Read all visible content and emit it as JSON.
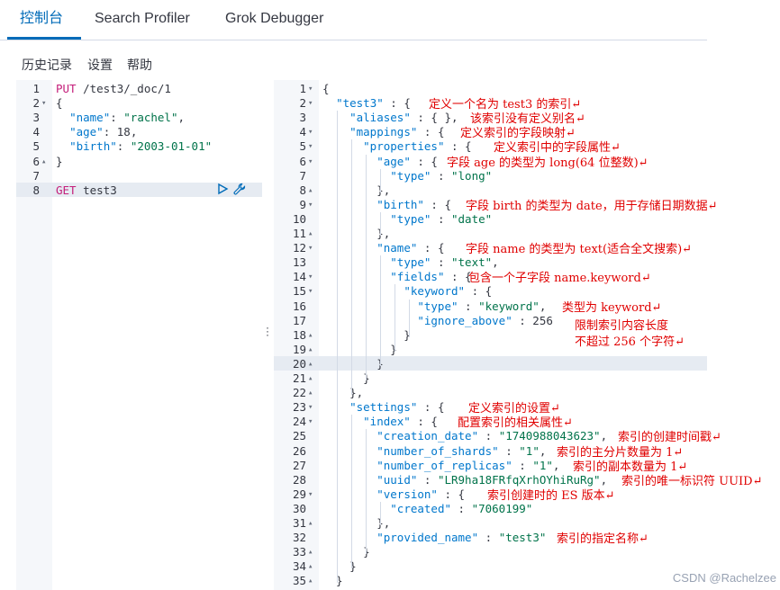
{
  "tabs": [
    "控制台",
    "Search Profiler",
    "Grok Debugger"
  ],
  "menu": [
    "历史记录",
    "设置",
    "帮助"
  ],
  "request_lines": [
    {
      "n": "1",
      "fold": "",
      "tokens": [
        [
          "m",
          "PUT"
        ],
        [
          "p",
          " /test3/_doc/1"
        ]
      ]
    },
    {
      "n": "2",
      "fold": "▾",
      "tokens": [
        [
          "p",
          "{"
        ]
      ]
    },
    {
      "n": "3",
      "fold": "",
      "tokens": [
        [
          "p",
          "  "
        ],
        [
          "k",
          "\"name\""
        ],
        [
          "p",
          ": "
        ],
        [
          "s",
          "\"rachel\""
        ],
        [
          "p",
          ","
        ]
      ]
    },
    {
      "n": "4",
      "fold": "",
      "tokens": [
        [
          "p",
          "  "
        ],
        [
          "k",
          "\"age\""
        ],
        [
          "p",
          ": "
        ],
        [
          "n",
          "18"
        ],
        [
          "p",
          ","
        ]
      ]
    },
    {
      "n": "5",
      "fold": "",
      "tokens": [
        [
          "p",
          "  "
        ],
        [
          "k",
          "\"birth\""
        ],
        [
          "p",
          ": "
        ],
        [
          "s",
          "\"2003-01-01\""
        ]
      ]
    },
    {
      "n": "6",
      "fold": "▴",
      "tokens": [
        [
          "p",
          "}"
        ]
      ]
    },
    {
      "n": "7",
      "fold": "",
      "tokens": []
    },
    {
      "n": "8",
      "fold": "",
      "tokens": [
        [
          "m",
          "GET"
        ],
        [
          "p",
          " test3"
        ]
      ]
    }
  ],
  "response_lines": [
    {
      "n": "1",
      "fold": "▾",
      "tokens": [
        [
          "p",
          "{"
        ]
      ]
    },
    {
      "n": "2",
      "fold": "▾",
      "tokens": [
        [
          "p",
          "  "
        ],
        [
          "k",
          "\"test3\""
        ],
        [
          "p",
          " : {"
        ]
      ]
    },
    {
      "n": "3",
      "fold": "",
      "tokens": [
        [
          "p",
          "    "
        ],
        [
          "k",
          "\"aliases\""
        ],
        [
          "p",
          " : { },"
        ]
      ]
    },
    {
      "n": "4",
      "fold": "▾",
      "tokens": [
        [
          "p",
          "    "
        ],
        [
          "k",
          "\"mappings\""
        ],
        [
          "p",
          " : {"
        ]
      ]
    },
    {
      "n": "5",
      "fold": "▾",
      "tokens": [
        [
          "p",
          "      "
        ],
        [
          "k",
          "\"properties\""
        ],
        [
          "p",
          " : {"
        ]
      ]
    },
    {
      "n": "6",
      "fold": "▾",
      "tokens": [
        [
          "p",
          "        "
        ],
        [
          "k",
          "\"age\""
        ],
        [
          "p",
          " : {"
        ]
      ]
    },
    {
      "n": "7",
      "fold": "",
      "tokens": [
        [
          "p",
          "          "
        ],
        [
          "k",
          "\"type\""
        ],
        [
          "p",
          " : "
        ],
        [
          "s",
          "\"long\""
        ]
      ]
    },
    {
      "n": "8",
      "fold": "▴",
      "tokens": [
        [
          "p",
          "        },"
        ]
      ]
    },
    {
      "n": "9",
      "fold": "▾",
      "tokens": [
        [
          "p",
          "        "
        ],
        [
          "k",
          "\"birth\""
        ],
        [
          "p",
          " : {"
        ]
      ]
    },
    {
      "n": "10",
      "fold": "",
      "tokens": [
        [
          "p",
          "          "
        ],
        [
          "k",
          "\"type\""
        ],
        [
          "p",
          " : "
        ],
        [
          "s",
          "\"date\""
        ]
      ]
    },
    {
      "n": "11",
      "fold": "▴",
      "tokens": [
        [
          "p",
          "        },"
        ]
      ]
    },
    {
      "n": "12",
      "fold": "▾",
      "tokens": [
        [
          "p",
          "        "
        ],
        [
          "k",
          "\"name\""
        ],
        [
          "p",
          " : {"
        ]
      ]
    },
    {
      "n": "13",
      "fold": "",
      "tokens": [
        [
          "p",
          "          "
        ],
        [
          "k",
          "\"type\""
        ],
        [
          "p",
          " : "
        ],
        [
          "s",
          "\"text\""
        ],
        [
          "p",
          ","
        ]
      ]
    },
    {
      "n": "14",
      "fold": "▾",
      "tokens": [
        [
          "p",
          "          "
        ],
        [
          "k",
          "\"fields\""
        ],
        [
          "p",
          " : {"
        ]
      ]
    },
    {
      "n": "15",
      "fold": "▾",
      "tokens": [
        [
          "p",
          "            "
        ],
        [
          "k",
          "\"keyword\""
        ],
        [
          "p",
          " : {"
        ]
      ]
    },
    {
      "n": "16",
      "fold": "",
      "tokens": [
        [
          "p",
          "              "
        ],
        [
          "k",
          "\"type\""
        ],
        [
          "p",
          " : "
        ],
        [
          "s",
          "\"keyword\""
        ],
        [
          "p",
          ","
        ]
      ]
    },
    {
      "n": "17",
      "fold": "",
      "tokens": [
        [
          "p",
          "              "
        ],
        [
          "k",
          "\"ignore_above\""
        ],
        [
          "p",
          " : "
        ],
        [
          "n",
          "256"
        ]
      ]
    },
    {
      "n": "18",
      "fold": "▴",
      "tokens": [
        [
          "p",
          "            }"
        ]
      ]
    },
    {
      "n": "19",
      "fold": "▴",
      "tokens": [
        [
          "p",
          "          }"
        ]
      ]
    },
    {
      "n": "20",
      "fold": "▴",
      "tokens": [
        [
          "p",
          "        }"
        ]
      ]
    },
    {
      "n": "21",
      "fold": "▴",
      "tokens": [
        [
          "p",
          "      }"
        ]
      ]
    },
    {
      "n": "22",
      "fold": "▴",
      "tokens": [
        [
          "p",
          "    },"
        ]
      ]
    },
    {
      "n": "23",
      "fold": "▾",
      "tokens": [
        [
          "p",
          "    "
        ],
        [
          "k",
          "\"settings\""
        ],
        [
          "p",
          " : {"
        ]
      ]
    },
    {
      "n": "24",
      "fold": "▾",
      "tokens": [
        [
          "p",
          "      "
        ],
        [
          "k",
          "\"index\""
        ],
        [
          "p",
          " : {"
        ]
      ]
    },
    {
      "n": "25",
      "fold": "",
      "tokens": [
        [
          "p",
          "        "
        ],
        [
          "k",
          "\"creation_date\""
        ],
        [
          "p",
          " : "
        ],
        [
          "s",
          "\"1740988043623\""
        ],
        [
          "p",
          ","
        ]
      ]
    },
    {
      "n": "26",
      "fold": "",
      "tokens": [
        [
          "p",
          "        "
        ],
        [
          "k",
          "\"number_of_shards\""
        ],
        [
          "p",
          " : "
        ],
        [
          "s",
          "\"1\""
        ],
        [
          "p",
          ","
        ]
      ]
    },
    {
      "n": "27",
      "fold": "",
      "tokens": [
        [
          "p",
          "        "
        ],
        [
          "k",
          "\"number_of_replicas\""
        ],
        [
          "p",
          " : "
        ],
        [
          "s",
          "\"1\""
        ],
        [
          "p",
          ","
        ]
      ]
    },
    {
      "n": "28",
      "fold": "",
      "tokens": [
        [
          "p",
          "        "
        ],
        [
          "k",
          "\"uuid\""
        ],
        [
          "p",
          " : "
        ],
        [
          "s",
          "\"LR9ha18FRfqXrhOYhiRuRg\""
        ],
        [
          "p",
          ","
        ]
      ]
    },
    {
      "n": "29",
      "fold": "▾",
      "tokens": [
        [
          "p",
          "        "
        ],
        [
          "k",
          "\"version\""
        ],
        [
          "p",
          " : {"
        ]
      ]
    },
    {
      "n": "30",
      "fold": "",
      "tokens": [
        [
          "p",
          "          "
        ],
        [
          "k",
          "\"created\""
        ],
        [
          "p",
          " : "
        ],
        [
          "s",
          "\"7060199\""
        ]
      ]
    },
    {
      "n": "31",
      "fold": "▴",
      "tokens": [
        [
          "p",
          "        },"
        ]
      ]
    },
    {
      "n": "32",
      "fold": "",
      "tokens": [
        [
          "p",
          "        "
        ],
        [
          "k",
          "\"provided_name\""
        ],
        [
          "p",
          " : "
        ],
        [
          "s",
          "\"test3\""
        ]
      ]
    },
    {
      "n": "33",
      "fold": "▴",
      "tokens": [
        [
          "p",
          "      }"
        ]
      ]
    },
    {
      "n": "34",
      "fold": "▴",
      "tokens": [
        [
          "p",
          "    }"
        ]
      ]
    },
    {
      "n": "35",
      "fold": "▴",
      "tokens": [
        [
          "p",
          "  }"
        ]
      ]
    }
  ],
  "annotations": [
    {
      "line": "2",
      "text": "定义一个名为 test3 的索引↵"
    },
    {
      "line": "3",
      "text": "该索引没有定义别名↵"
    },
    {
      "line": "4",
      "text": "定义索引的字段映射↵"
    },
    {
      "line": "5",
      "text": "定义索引中的字段属性↵"
    },
    {
      "line": "6",
      "text": "字段 age 的类型为 long(64 位整数)↵"
    },
    {
      "line": "9",
      "text": "字段 birth 的类型为 date，用于存储日期数据↵"
    },
    {
      "line": "12",
      "text": "字段 name 的类型为 text(适合全文搜索)↵"
    },
    {
      "line": "14",
      "text": "包含一个子字段 name.keyword↵"
    },
    {
      "line": "16",
      "text": "类型为 keyword↵"
    },
    {
      "line": "17",
      "text": "限制索引内容长度"
    },
    {
      "line": "18",
      "text": "不超过 256 个字符↵"
    },
    {
      "line": "23",
      "text": "定义索引的设置↵"
    },
    {
      "line": "24",
      "text": "配置索引的相关属性↵"
    },
    {
      "line": "25",
      "text": "索引的创建时间戳↵"
    },
    {
      "line": "26",
      "text": "索引的主分片数量为 1↵"
    },
    {
      "line": "27",
      "text": "索引的副本数量为 1↵"
    },
    {
      "line": "28",
      "text": "索引的唯一标识符 UUID↵"
    },
    {
      "line": "29",
      "text": "索引创建时的 ES 版本↵"
    },
    {
      "line": "32",
      "text": "索引的指定名称↵"
    }
  ],
  "watermark": "CSDN @Rachelzee",
  "colors": {
    "accent": "#006bb8",
    "annotation": "#e00000",
    "method": "#c41e7a",
    "key": "#0077cc",
    "string": "#00734a"
  },
  "icons": [
    "play-icon",
    "wrench-icon"
  ]
}
